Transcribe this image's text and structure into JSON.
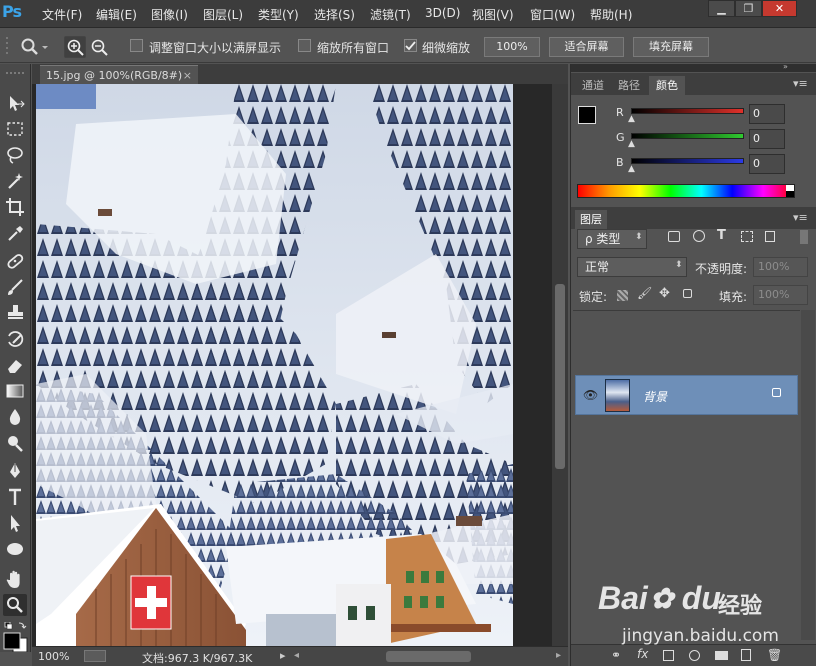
{
  "app": {
    "logo": "Ps",
    "menu": [
      "文件(F)",
      "编辑(E)",
      "图像(I)",
      "图层(L)",
      "类型(Y)",
      "选择(S)",
      "滤镜(T)",
      "3D(D)",
      "视图(V)",
      "窗口(W)",
      "帮助(H)"
    ],
    "window_controls": {
      "minimize": "▁",
      "restore": "❐",
      "close": "✕"
    }
  },
  "options": {
    "resize_windows": "调整窗口大小以满屏显示",
    "zoom_all": "缩放所有窗口",
    "scrubby_zoom": "细微缩放",
    "scrubby_checked": true,
    "zoom_100": "100%",
    "fit_screen": "适合屏幕",
    "fill_screen": "填充屏幕"
  },
  "document": {
    "tab_title": "15.jpg @ 100%(RGB/8#)",
    "close": "×"
  },
  "status": {
    "zoom": "100%",
    "doc_info": "文档:967.3 K/967.3K",
    "arrow": "▸"
  },
  "panels": {
    "top_tabs": [
      "通道",
      "路径",
      "颜色"
    ],
    "color": {
      "r_label": "R",
      "g_label": "G",
      "b_label": "B",
      "r": "0",
      "g": "0",
      "b": "0",
      "r_color": "#e0302a",
      "g_color": "#2fc92f",
      "b_color": "#2b3ae6"
    },
    "layers_tab": "图层",
    "filter_type": "ρ 类型",
    "blend_mode": "正常",
    "opacity_label": "不透明度:",
    "opacity": "100%",
    "lock_label": "锁定:",
    "fill_label": "填充:",
    "fill": "100%",
    "layer_name": "背景"
  },
  "watermark": {
    "brand": "Bai",
    "brand_suffix": "du",
    "brand_cn": "经验",
    "url": "jingyan.baidu.com"
  }
}
